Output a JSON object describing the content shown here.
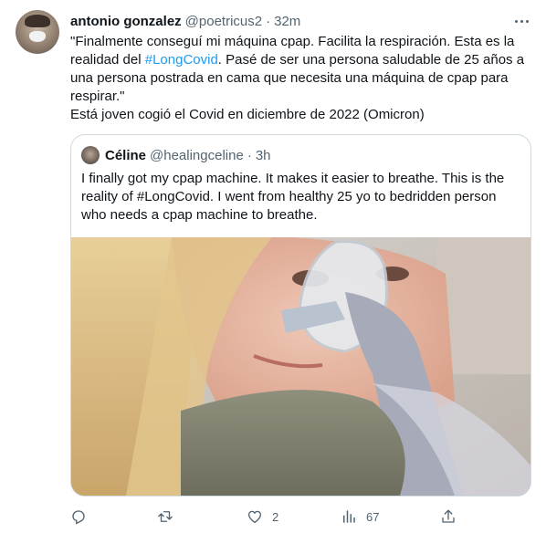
{
  "tweet": {
    "author_name": "antonio gonzalez",
    "author_handle": "@poetricus2",
    "separator": "·",
    "time": "32m",
    "text_lines": [
      "\"Finalmente conseguí mi máquina cpap. Facilita la respiración. Esta es la",
      "realidad del ",
      "una persona postrada en cama que necesita una máquina de cpap para",
      "respirar.\"",
      "Está joven cogió el Covid en diciembre de 2022 (Omicron)"
    ],
    "hashtag": "#LongCovid",
    "line2_rest": ". Pasé de ser una persona saludable de 25 años a"
  },
  "quoted": {
    "author_name": "Céline",
    "author_handle": "@healingceline",
    "separator": "·",
    "time": "3h",
    "text_lines": [
      "I finally got my cpap machine. It makes it easier to breathe. This is the",
      "reality of #LongCovid. I went from healthy 25 yo to bedridden person",
      "who needs a cpap machine to breathe."
    ]
  },
  "actions": {
    "reply": {
      "icon": "reply-icon",
      "count": ""
    },
    "retweet": {
      "icon": "retweet-icon",
      "count": ""
    },
    "like": {
      "icon": "heart-icon",
      "count": "2"
    },
    "views": {
      "icon": "views-chart-icon",
      "count": "67"
    },
    "share": {
      "icon": "share-icon",
      "count": ""
    }
  },
  "colors": {
    "link": "#1d9bf0",
    "secondary_text": "#536471",
    "border": "#cfd9de"
  }
}
